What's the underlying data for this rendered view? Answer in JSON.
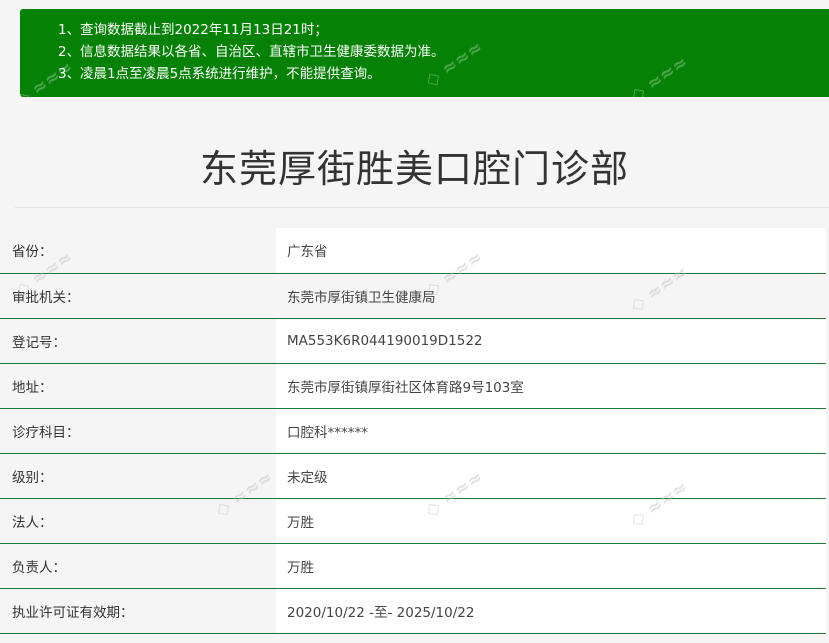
{
  "notice": {
    "items": [
      {
        "num": "1、",
        "text": "查询数据截止到2022年11月13日21时；"
      },
      {
        "num": "2、",
        "text": "信息数据结果以各省、自治区、直辖市卫生健康委数据为准。"
      },
      {
        "num": "3、",
        "text": "凌晨1点至凌晨5点系统进行维护，不能提供查询。"
      }
    ]
  },
  "title": "东莞厚街胜美口腔门诊部",
  "rows": [
    {
      "label": "省份：",
      "value": "广东省"
    },
    {
      "label": "审批机关：",
      "value": "东莞市厚街镇卫生健康局"
    },
    {
      "label": "登记号：",
      "value": "MA553K6R044190019D1522"
    },
    {
      "label": "地址：",
      "value": "东莞市厚街镇厚街社区体育路9号103室"
    },
    {
      "label": "诊疗科目：",
      "value": "口腔科******"
    },
    {
      "label": "级别：",
      "value": "未定级"
    },
    {
      "label": "法人：",
      "value": "万胜"
    },
    {
      "label": "负责人：",
      "value": "万胜"
    },
    {
      "label": "执业许可证有效期：",
      "value": "2020/10/22 -至- 2025/10/22"
    }
  ],
  "colors": {
    "notice_bg": "#058205",
    "row_border": "#1f7a3a",
    "title": "#333333"
  }
}
